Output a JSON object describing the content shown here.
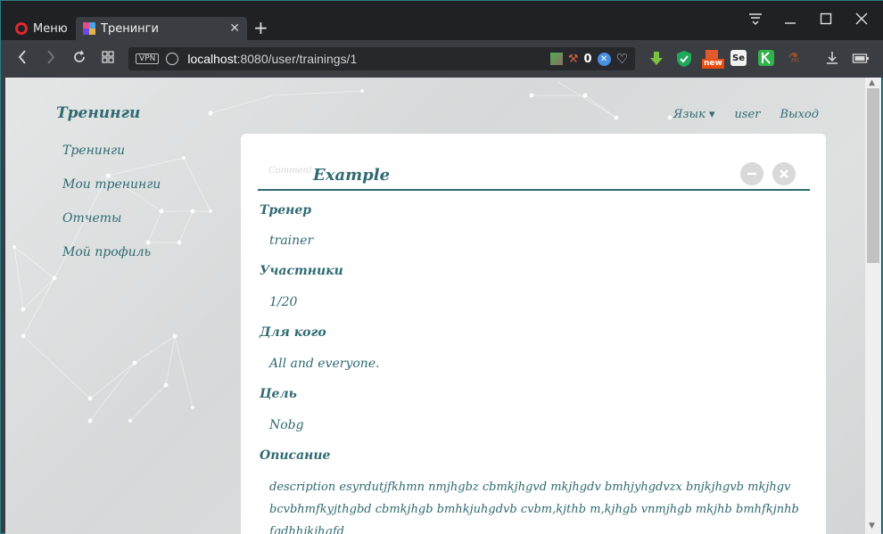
{
  "browser": {
    "menu_label": "Меню",
    "tab_title": "Тренинги",
    "url_host": "localhost",
    "url_rest": ":8080/user/trainings/1",
    "vpn_label": "VPN",
    "tracker_count": "0",
    "ext_new_badge": "new",
    "ext_se_label": "Se"
  },
  "app": {
    "brand": "Тренинги",
    "sidebar": [
      {
        "label": "Тренинги"
      },
      {
        "label": "Мои тренинги"
      },
      {
        "label": "Отчеты"
      },
      {
        "label": "Мой профиль"
      }
    ],
    "topnav": {
      "language": "Язык ▾",
      "user": "user",
      "logout": "Выход"
    }
  },
  "training": {
    "ghost_text": "Comment",
    "title": "Example",
    "fields": [
      {
        "label": "Тренер",
        "value": "trainer"
      },
      {
        "label": "Участники",
        "value": "1/20"
      },
      {
        "label": "Для кого",
        "value": "All and everyone."
      },
      {
        "label": "Цель",
        "value": "Nobg"
      },
      {
        "label": "Описание",
        "value": ""
      }
    ],
    "description": "description esyrdutjfkhmn nmjhgbz cbmkjhgvd mkjhgdv bmhjyhgdvzx bnjkjhgvb mkjhgv bcvbhmfkyjthgbd cbmkjhgb bmhkjuhgdvb cvbm,kjthb m,kjhgb vnmjhgb mkjhb bmhfkjnhb fgdhhjkjhgfd"
  }
}
